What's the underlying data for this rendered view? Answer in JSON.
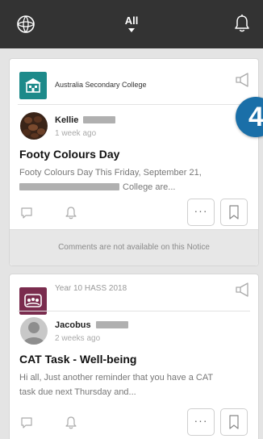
{
  "header": {
    "filter_label": "All"
  },
  "notices": [
    {
      "source": "Australia Secondary College",
      "author_first": "Kellie",
      "time": "1 week ago",
      "title": "Footy Colours Day",
      "body_line1": "Footy Colours Day This Friday, September 21,",
      "body_line2": "College are...",
      "footer": "Comments are not available on this Notice"
    },
    {
      "source": "Year 10 HASS 2018",
      "author_first": "Jacobus",
      "time": "2 weeks ago",
      "title": "CAT Task - Well-being",
      "body_line1": "Hi all, Just another reminder that you have a CAT",
      "body_line2": "task due next Thursday and..."
    }
  ],
  "more_label": "···",
  "step_badge": "4",
  "colors": {
    "topbar": "#333333",
    "school_icon": "#1d8a8a",
    "class_icon": "#7a2c4e",
    "badge": "#1a6fa8"
  }
}
